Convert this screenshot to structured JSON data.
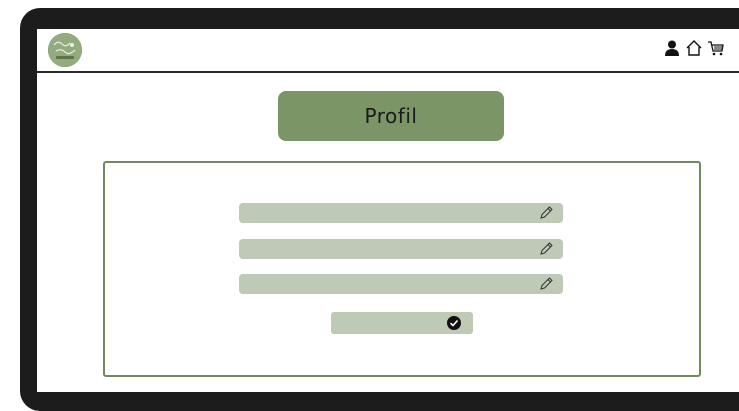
{
  "header": {
    "logo_icon": "app-logo",
    "user_icon": "user-icon",
    "home_icon": "home-icon",
    "cart_icon": "cart-icon"
  },
  "main": {
    "title": "Profil"
  },
  "form": {
    "fields": [
      {
        "value": "",
        "icon": "pencil-icon"
      },
      {
        "value": "",
        "icon": "pencil-icon"
      },
      {
        "value": "",
        "icon": "pencil-icon"
      }
    ],
    "confirm_icon": "check-circle-icon"
  },
  "colors": {
    "accent": "#7b9566",
    "field_bg": "#bec9b6",
    "panel_border": "#6f8a5c",
    "frame": "#1c1c1c"
  }
}
